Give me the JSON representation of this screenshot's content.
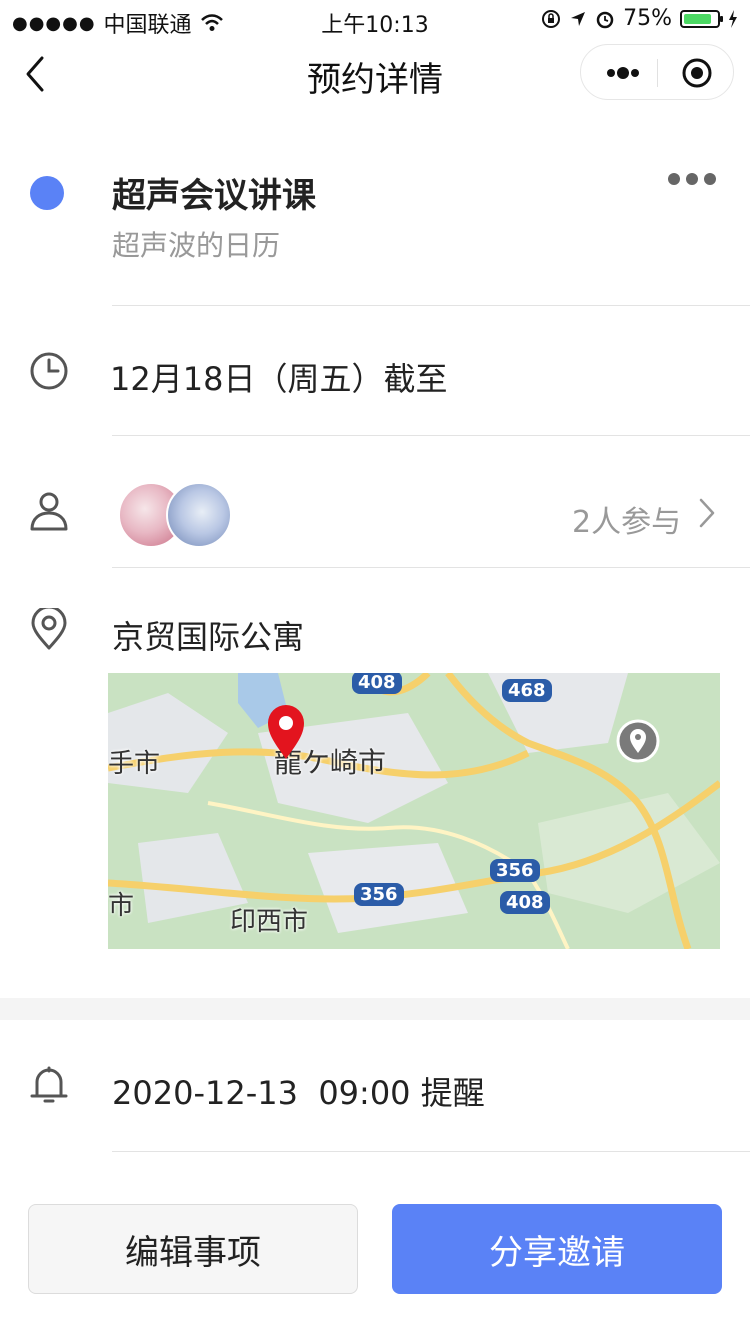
{
  "status_bar": {
    "carrier": "中国联通",
    "time": "上午10:13",
    "battery": "75%",
    "battery_level": 0.75
  },
  "nav": {
    "title": "预约详情"
  },
  "event": {
    "title": "超声会议讲课",
    "calendar": "超声波的日历",
    "dot_color": "#5a82f6"
  },
  "deadline": {
    "text": "12月18日（周五）截至"
  },
  "participants": {
    "text": "2人参与"
  },
  "location": {
    "name": "京贸国际公寓",
    "map": {
      "labels": [
        "龍ケ崎市",
        "手市",
        "印西市",
        "市"
      ],
      "roads": [
        "408",
        "468",
        "356",
        "356",
        "408"
      ]
    }
  },
  "reminder": {
    "text": "2020-12-13  09:00 提醒"
  },
  "buttons": {
    "edit": "编辑事项",
    "share": "分享邀请"
  },
  "colors": {
    "accent": "#5a82f6"
  }
}
